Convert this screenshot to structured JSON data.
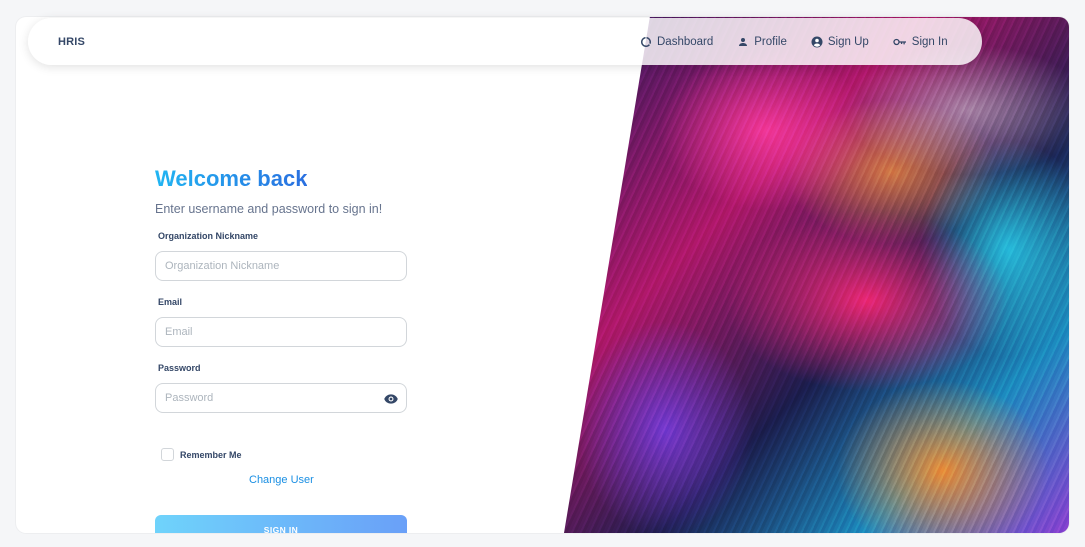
{
  "navbar": {
    "brand": "HRIS",
    "links": [
      {
        "label": "Dashboard",
        "icon": "dashboard-icon"
      },
      {
        "label": "Profile",
        "icon": "person-icon"
      },
      {
        "label": "Sign Up",
        "icon": "account-circle-icon"
      },
      {
        "label": "Sign In",
        "icon": "key-icon"
      }
    ]
  },
  "form": {
    "title": "Welcome back",
    "subtitle": "Enter username and password to sign in!",
    "org": {
      "label": "Organization Nickname",
      "placeholder": "Organization Nickname",
      "value": ""
    },
    "email": {
      "label": "Email",
      "placeholder": "Email",
      "value": ""
    },
    "password": {
      "label": "Password",
      "placeholder": "Password",
      "value": ""
    },
    "remember_label": "Remember Me",
    "change_user": "Change User",
    "submit_label": "SIGN IN"
  },
  "colors": {
    "accent": "#1a8fe3",
    "title_gradient_start": "#21b5f2",
    "title_gradient_end": "#2a6fe0",
    "button_gradient_start": "#6fd3fb",
    "button_gradient_end": "#6aa0f8",
    "text_dark": "#344767",
    "text_muted": "#67748e"
  }
}
